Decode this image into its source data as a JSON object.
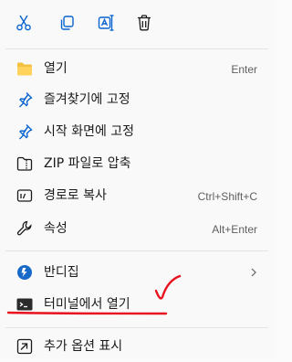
{
  "toolbar": {
    "buttons": [
      {
        "name": "cut-icon"
      },
      {
        "name": "copy-icon"
      },
      {
        "name": "rename-icon"
      },
      {
        "name": "delete-icon"
      }
    ]
  },
  "menu": {
    "items": [
      {
        "label": "열기",
        "shortcut": "Enter",
        "icon": "folder-icon"
      },
      {
        "label": "즐겨찾기에 고정",
        "shortcut": "",
        "icon": "pin-icon"
      },
      {
        "label": "시작 화면에 고정",
        "shortcut": "",
        "icon": "pin-icon"
      },
      {
        "label": "ZIP 파일로 압축",
        "shortcut": "",
        "icon": "zip-icon"
      },
      {
        "label": "경로로 복사",
        "shortcut": "Ctrl+Shift+C",
        "icon": "copy-path-icon"
      },
      {
        "label": "속성",
        "shortcut": "Alt+Enter",
        "icon": "wrench-icon"
      },
      {
        "label": "반디집",
        "shortcut": "",
        "icon": "bandizip-icon"
      },
      {
        "label": "터미널에서 열기",
        "shortcut": "",
        "icon": "terminal-icon"
      },
      {
        "label": "추가 옵션 표시",
        "shortcut": "",
        "icon": "more-options-icon"
      }
    ]
  },
  "colors": {
    "accent": "#0a64d0",
    "annotation": "#e8111d",
    "background": "#f9f9f9",
    "separator": "#e3e3e3"
  }
}
